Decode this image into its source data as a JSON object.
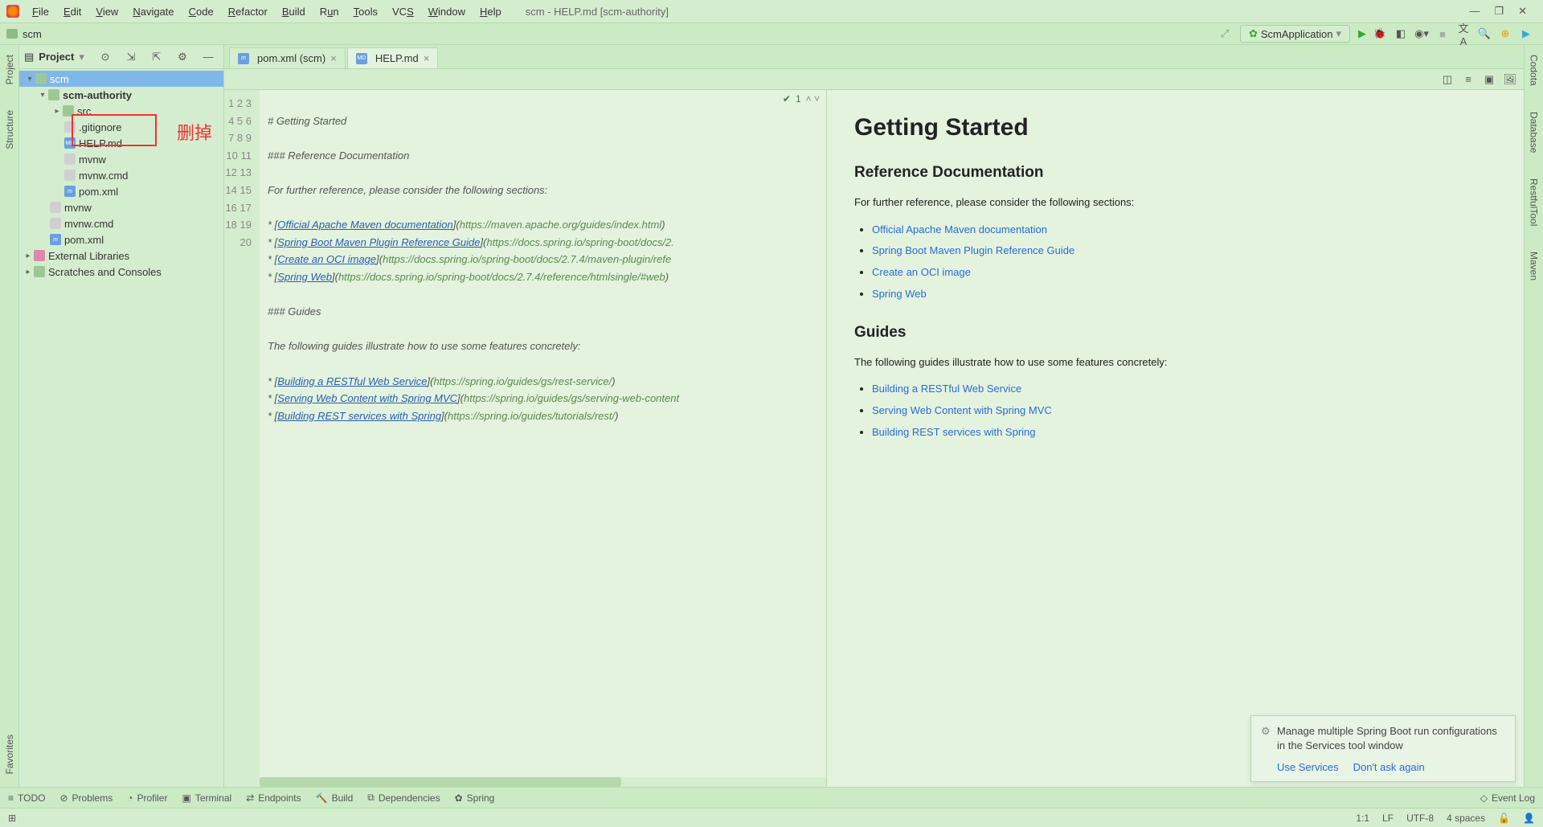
{
  "window": {
    "title": "scm - HELP.md [scm-authority]"
  },
  "menu": [
    "File",
    "Edit",
    "View",
    "Navigate",
    "Code",
    "Refactor",
    "Build",
    "Run",
    "Tools",
    "VCS",
    "Window",
    "Help"
  ],
  "breadcrumb": {
    "text": "scm"
  },
  "run_config": {
    "label": "ScmApplication"
  },
  "left_tabs": [
    "Project",
    "Structure",
    "Favorites"
  ],
  "right_tabs": [
    "Codota",
    "Database",
    "RestfulTool",
    "Maven"
  ],
  "project": {
    "title": "Project",
    "tree": {
      "root": "scm",
      "mod": "scm-authority",
      "src": "src",
      "gitignore": ".gitignore",
      "help": "HELP.md",
      "mvnw1": "mvnw",
      "mvnwcmd1": "mvnw.cmd",
      "pom1": "pom.xml",
      "mvnw2": "mvnw",
      "mvnwcmd2": "mvnw.cmd",
      "pom2": "pom.xml",
      "ext": "External Libraries",
      "scratch": "Scratches and Consoles"
    }
  },
  "annotation": {
    "red_text": "删掉"
  },
  "tabs": [
    {
      "label": "pom.xml (scm)",
      "icon": "m"
    },
    {
      "label": "HELP.md",
      "icon": "MD"
    }
  ],
  "code_badge": {
    "count": "1"
  },
  "code": {
    "line_count": 20,
    "l1": "# Getting Started",
    "l3": "### Reference Documentation",
    "l5": "For further reference, please consider the following sections:",
    "l7a": "Official Apache Maven documentation",
    "l7b": "https://maven.apache.org/guides/index.html",
    "l8a": "Spring Boot Maven Plugin Reference Guide",
    "l8b": "https://docs.spring.io/spring-boot/docs/2.",
    "l9a": "Create an OCI image",
    "l9b": "https://docs.spring.io/spring-boot/docs/2.7.4/maven-plugin/refe",
    "l10a": "Spring Web",
    "l10b": "https://docs.spring.io/spring-boot/docs/2.7.4/reference/htmlsingle/#web",
    "l12": "### Guides",
    "l14": "The following guides illustrate how to use some features concretely:",
    "l16a": "Building a RESTful Web Service",
    "l16b": "https://spring.io/guides/gs/rest-service/",
    "l17a": "Serving Web Content with Spring MVC",
    "l17b": "https://spring.io/guides/gs/serving-web-content",
    "l18a": "Building REST services with Spring",
    "l18b": "https://spring.io/guides/tutorials/rest/"
  },
  "preview": {
    "h1": "Getting Started",
    "h2a": "Reference Documentation",
    "p1": "For further reference, please consider the following sections:",
    "ref_links": [
      "Official Apache Maven documentation",
      "Spring Boot Maven Plugin Reference Guide",
      "Create an OCI image",
      "Spring Web"
    ],
    "h2b": "Guides",
    "p2": "The following guides illustrate how to use some features concretely:",
    "guide_links": [
      "Building a RESTful Web Service",
      "Serving Web Content with Spring MVC",
      "Building REST services with Spring"
    ]
  },
  "bottom": {
    "todo": "TODO",
    "problems": "Problems",
    "profiler": "Profiler",
    "terminal": "Terminal",
    "endpoints": "Endpoints",
    "build": "Build",
    "deps": "Dependencies",
    "spring": "Spring",
    "eventlog": "Event Log"
  },
  "status": {
    "pos": "1:1",
    "le": "LF",
    "enc": "UTF-8",
    "indent": "4 spaces"
  },
  "notif": {
    "msg": "Manage multiple Spring Boot run configurations in the Services tool window",
    "a1": "Use Services",
    "a2": "Don't ask again"
  }
}
